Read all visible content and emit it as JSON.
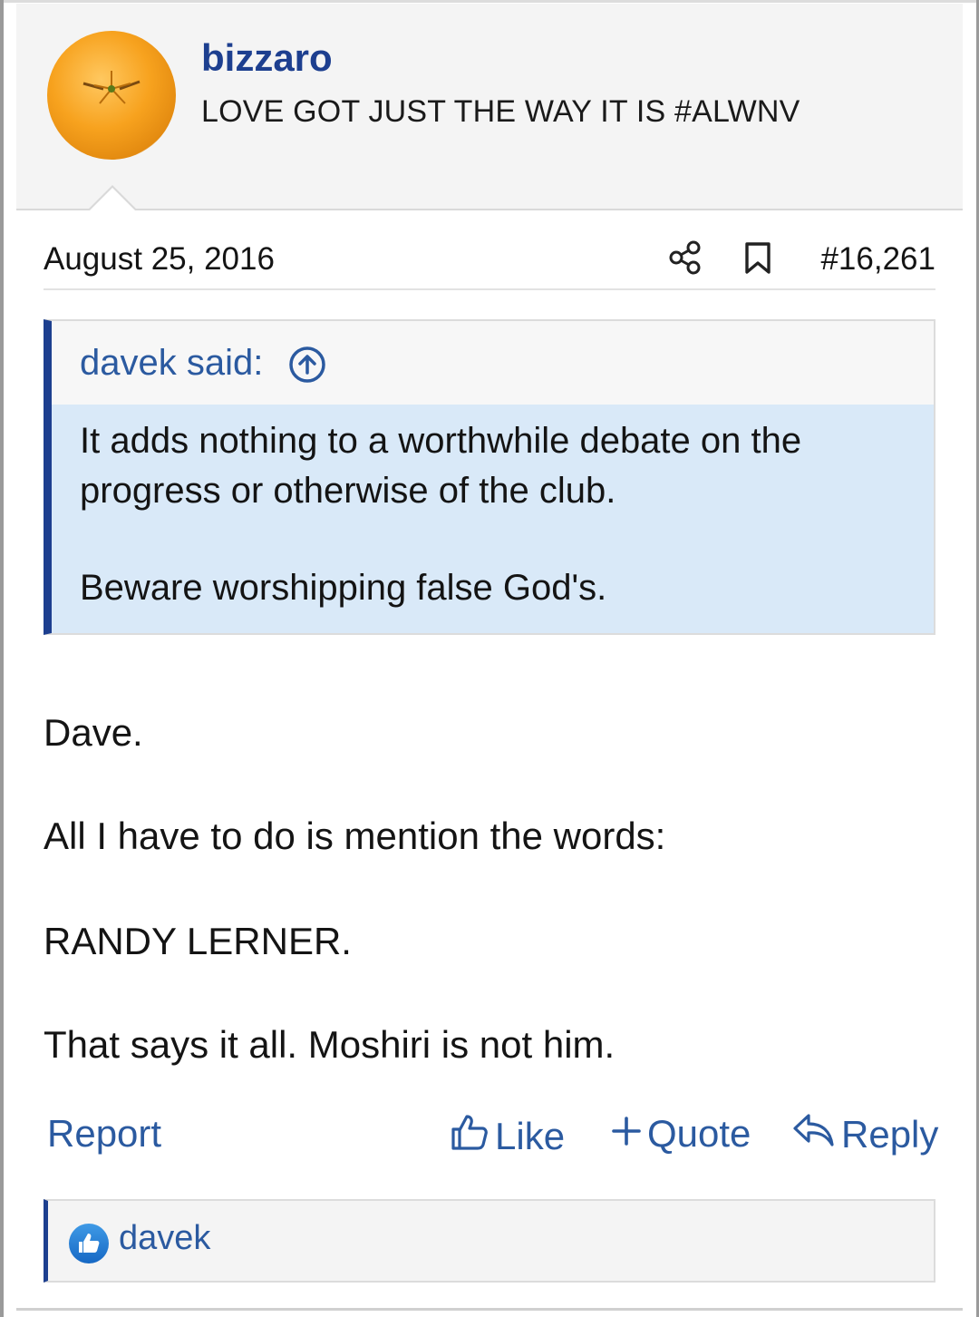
{
  "user": {
    "name": "bizzaro",
    "title": "LOVE GOT JUST THE WAY IT IS #ALWNV",
    "avatar_icon": "orange-fruit-avatar"
  },
  "post": {
    "date": "August 25, 2016",
    "number": "#16,261",
    "share_icon": "share-icon",
    "bookmark_icon": "bookmark-icon"
  },
  "quote": {
    "author_label": "davek said:",
    "jump_icon": "arrow-up-circle-icon",
    "lines": [
      "It adds nothing to a worthwhile debate on the",
      "progress or otherwise of the club.",
      "Beware worshipping false God's."
    ]
  },
  "message": {
    "lines": [
      "Dave.",
      "All I have to do is mention the words:",
      "RANDY LERNER.",
      "That says it all. Moshiri is not him."
    ]
  },
  "actions": {
    "report": "Report",
    "like": "Like",
    "quote": "Quote",
    "reply": "Reply"
  },
  "reactions": {
    "icon": "thumbs-up-reaction-icon",
    "users": "davek"
  },
  "colors": {
    "accent": "#1d3f8f",
    "link": "#2b5aa0",
    "quote_bg": "#d9e9f8"
  }
}
